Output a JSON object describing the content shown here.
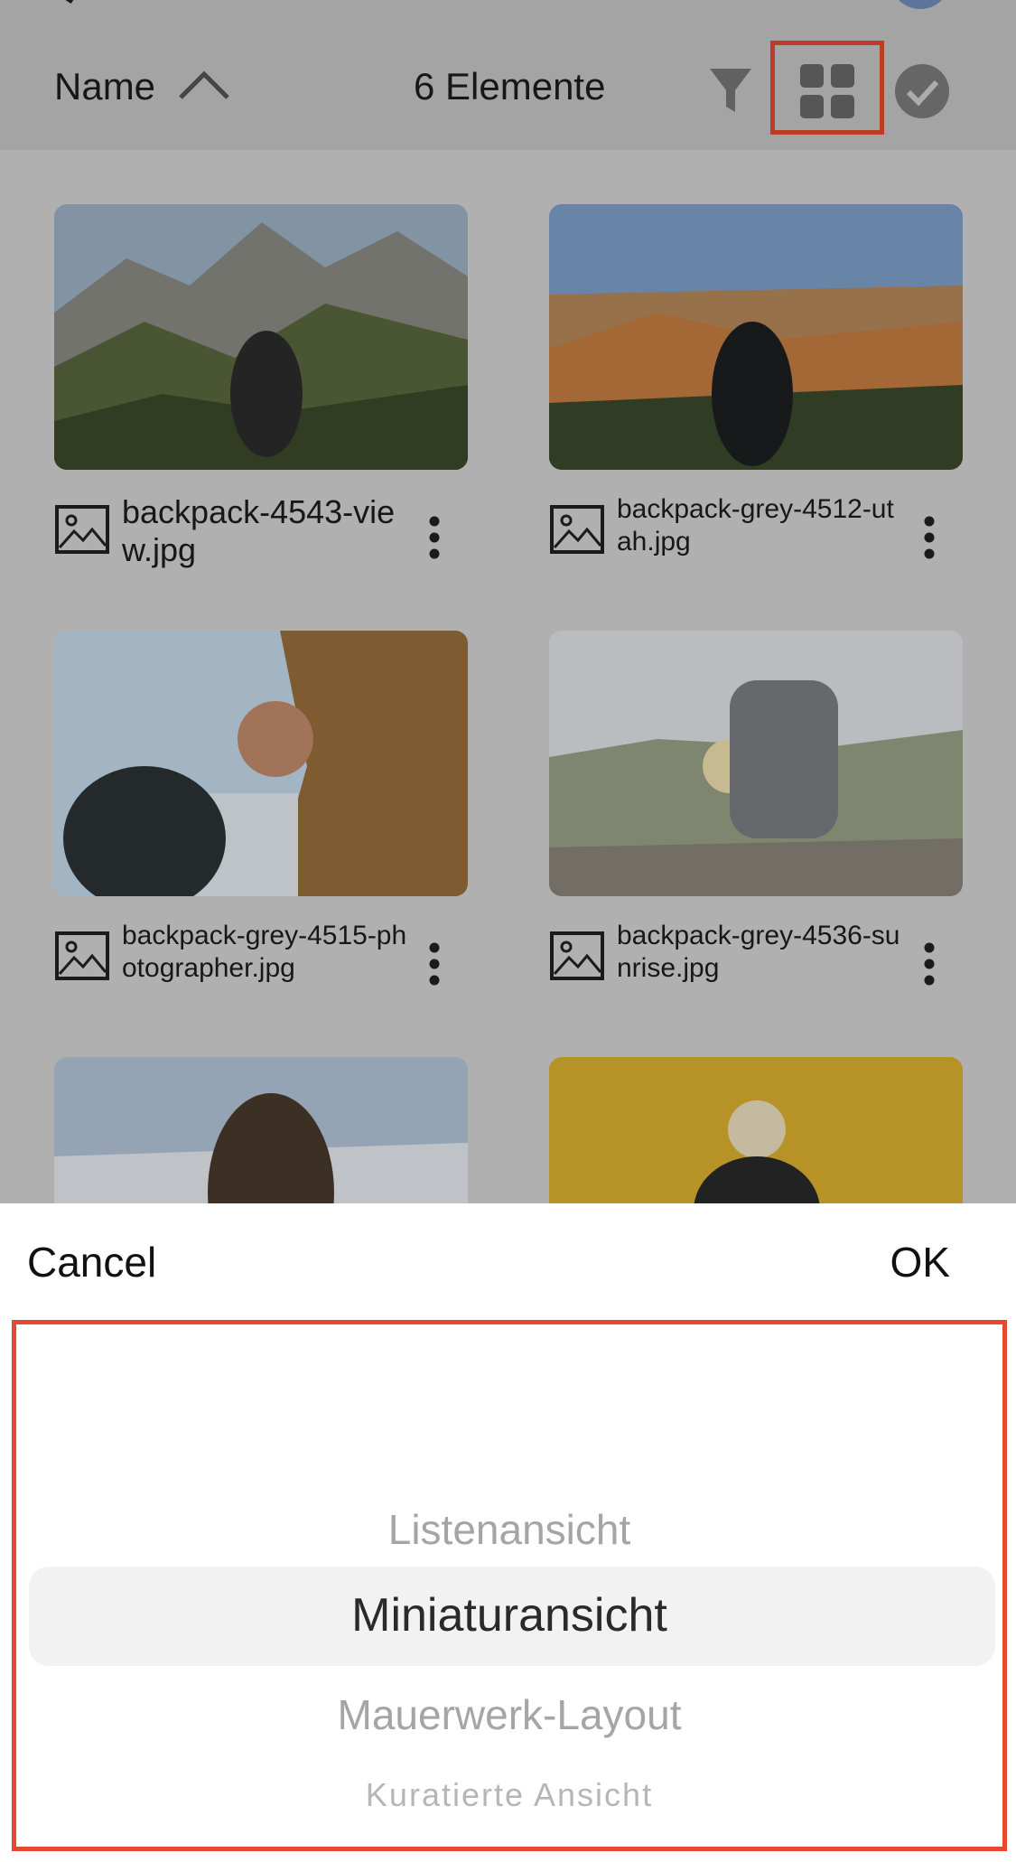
{
  "toolbar": {
    "sort_label": "Name",
    "item_count": "6 Elemente"
  },
  "files": [
    {
      "name": "backpack-4543-view.jpg"
    },
    {
      "name": "backpack-grey-4512-utah.jpg"
    },
    {
      "name": "backpack-grey-4515-photographer.jpg"
    },
    {
      "name": "backpack-grey-4536-sunrise.jpg"
    },
    {
      "name": ""
    },
    {
      "name": ""
    }
  ],
  "sheet": {
    "cancel_label": "Cancel",
    "ok_label": "OK",
    "options": [
      "Listenansicht",
      "Miniaturansicht",
      "Mauerwerk-Layout",
      "Kuratierte Ansicht"
    ],
    "selected_option": "Miniaturansicht"
  },
  "colors": {
    "highlight_border": "#e64a2e",
    "toolbar_bg": "#c9c9c9",
    "sheet_bg": "#ffffff"
  }
}
